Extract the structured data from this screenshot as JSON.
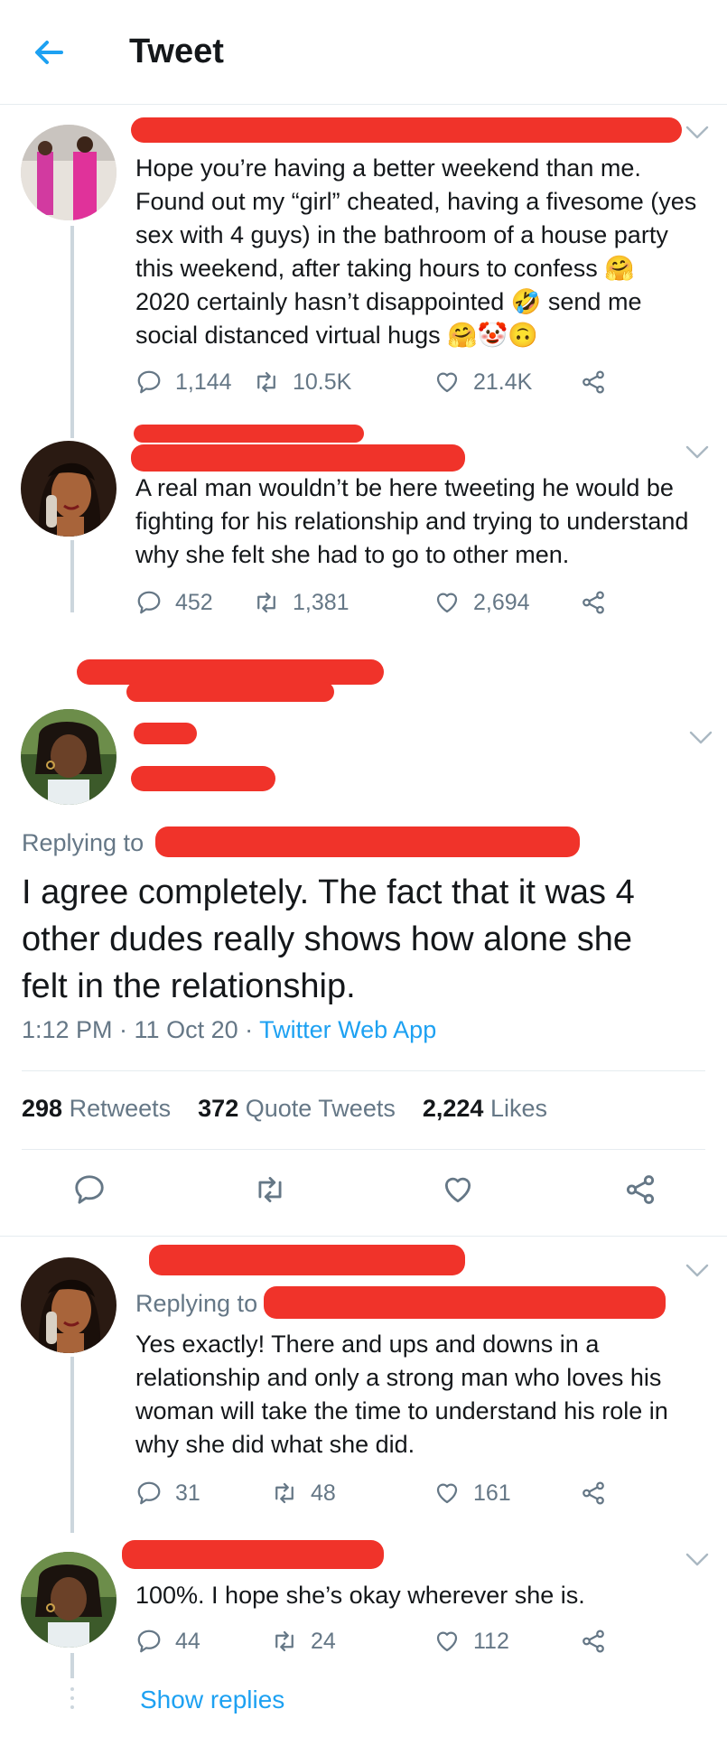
{
  "header": {
    "title": "Tweet"
  },
  "colors": {
    "accent": "#1da1f2",
    "muted": "#657786",
    "text": "#14171a",
    "redaction": "#f0332a"
  },
  "tweet1": {
    "lines": [
      "Hope you’re having a better weekend than me.",
      "Found out my “girl” cheated, having a fivesome (yes",
      "sex with 4 guys) in the bathroom of a house party",
      "this weekend, after taking hours to confess 🤗",
      "2020 certainly hasn’t disappointed 🤣 send me",
      "social distanced virtual hugs 🤗🤡🙃"
    ],
    "replies": "1,144",
    "retweets": "10.5K",
    "likes": "21.4K"
  },
  "tweet2": {
    "lines": [
      "A real man wouldn’t be here tweeting he would be",
      "fighting for his relationship and trying to understand",
      "why she felt she had to go to other men."
    ],
    "replies": "452",
    "retweets": "1,381",
    "likes": "2,694"
  },
  "main": {
    "replying_to": "Replying to",
    "lines": [
      "I agree completely. The fact that it was 4",
      "other dudes really shows how alone she",
      "felt in the relationship."
    ],
    "time": "1:12 PM · 11 Oct 20 · ",
    "app": "Twitter Web App",
    "retweets_count": "298",
    "retweets_label": "Retweets",
    "quotes_count": "372",
    "quotes_label": "Quote Tweets",
    "likes_count": "2,224",
    "likes_label": "Likes"
  },
  "reply1": {
    "replying_to": "Replying to",
    "lines": [
      "Yes exactly! There and ups and downs in a",
      "relationship and only a strong man who loves his",
      "woman will take the time to understand his role in",
      "why she did what she did."
    ],
    "replies": "31",
    "retweets": "48",
    "likes": "161"
  },
  "reply2": {
    "lines": [
      "100%. I hope she’s okay wherever she is."
    ],
    "replies": "44",
    "retweets": "24",
    "likes": "112",
    "show_replies": "Show replies"
  }
}
